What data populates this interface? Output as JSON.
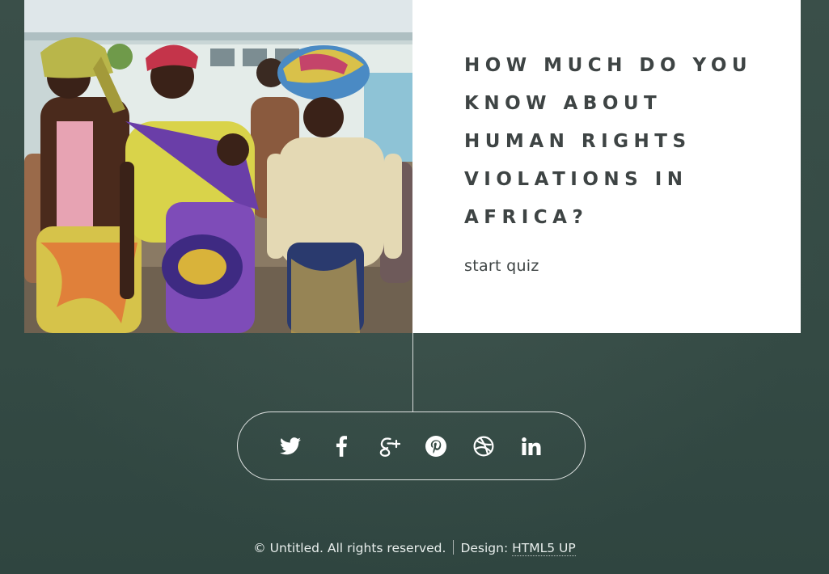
{
  "hero": {
    "headline": "HOW MUCH DO YOU KNOW ABOUT HUMAN RIGHTS VIOLATIONS IN AFRICA?",
    "cta_label": "start quiz"
  },
  "social": {
    "items": [
      {
        "name": "twitter",
        "icon": "twitter-icon"
      },
      {
        "name": "facebook",
        "icon": "facebook-icon"
      },
      {
        "name": "google-plus",
        "icon": "google-plus-icon"
      },
      {
        "name": "pinterest",
        "icon": "pinterest-icon"
      },
      {
        "name": "dribbble",
        "icon": "dribbble-icon"
      },
      {
        "name": "linkedin",
        "icon": "linkedin-icon"
      }
    ]
  },
  "footer": {
    "copyright": "© Untitled. All rights reserved.",
    "design_label": "Design:",
    "design_link": "HTML5 UP"
  },
  "colors": {
    "background": "#354a44",
    "panel": "#ffffff",
    "headline_text": "#3e4444",
    "footer_text": "#e8eeec"
  }
}
